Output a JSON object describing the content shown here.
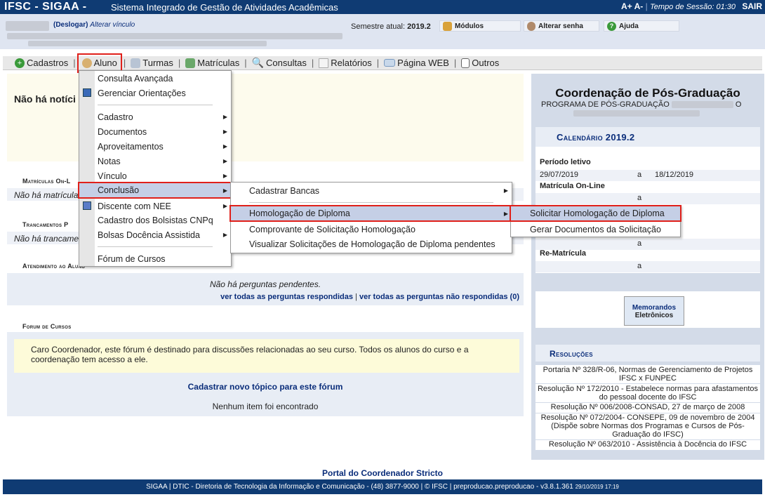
{
  "header": {
    "brand": "IFSC - SIGAA -",
    "subtitle": "Sistema Integrado de Gestão de Atividades Acadêmicas",
    "font_controls": "A+ A-",
    "session_label": "Tempo de Sessão: 01:30",
    "logout": "SAIR"
  },
  "userbar": {
    "deslogar": "(Deslogar)",
    "alterar_vinculo": "Alterar vínculo",
    "semestre_label": "Semestre atual:",
    "semestre_value": "2019.2",
    "modulos": "Módulos",
    "alterar_senha": "Alterar senha",
    "ajuda": "Ajuda"
  },
  "menu": {
    "cadastros": "Cadastros",
    "aluno": "Aluno",
    "turmas": "Turmas",
    "matriculas": "Matrículas",
    "consultas": "Consultas",
    "relatorios": "Relatórios",
    "pagina_web": "Página WEB",
    "outros": "Outros"
  },
  "aluno_menu": [
    "Consulta Avançada",
    "Gerenciar Orientações",
    "Cadastro",
    "Documentos",
    "Aproveitamentos",
    "Notas",
    "Vínculo",
    "Conclusão",
    "Discente com NEE",
    "Cadastro dos Bolsistas CNPq",
    "Bolsas Docência Assistida",
    "Fórum de Cursos"
  ],
  "conclusao_menu": [
    "Cadastrar Bancas",
    "Homologação de Diploma",
    "Comprovante de Solicitação Homologação",
    "Visualizar Solicitações de Homologação de Diploma pendentes"
  ],
  "homologacao_menu": [
    "Solicitar Homologação de Diploma",
    "Gerar Documentos da Solicitação"
  ],
  "main": {
    "no_news": "Não há notíci",
    "matriculas_title": "Matrículas On-L",
    "matriculas_text": "Não há matrícula",
    "trancamentos_title": "Trancamentos P",
    "trancamentos_text": "Não há trancame",
    "atendimento_title": "Atendimento ao Aluno",
    "no_questions": "Não há perguntas pendentes.",
    "link_respondidas": "ver todas as perguntas respondidas",
    "link_nao_respondidas": "ver todas as perguntas não respondidas (0)",
    "forum_title": "Forum de Cursos",
    "forum_text": "Caro Coordenador, este fórum é destinado para discussões relacionadas ao seu curso. Todos os alunos do curso e a coordenação tem acesso a ele.",
    "forum_link": "Cadastrar novo tópico para este fórum",
    "forum_empty": "Nenhum item foi encontrado"
  },
  "sidebar": {
    "title": "Coordenação de Pós-Graduação",
    "program": "PROGRAMA DE PÓS-GRADUAÇÃO",
    "program_end": "O",
    "calendar_title": "Calendário 2019.2",
    "periodo_label": "Período letivo",
    "periodo_start": "29/07/2019",
    "a": "a",
    "periodo_end": "18/12/2019",
    "matricula_label": "Matrícula On-Line",
    "rematricula_label": "Re-Matrícula",
    "memorandos_1": "Memorandos",
    "memorandos_2": "Eletrônicos",
    "resolucoes_title": "Resoluções",
    "resolucoes": [
      "Portaria Nº 328/R-06, Normas de Gerenciamento de Projetos IFSC x FUNPEC",
      "Resolução Nº 172/2010 - Estabelece normas para afastamentos do pessoal docente do IFSC",
      "Resolução Nº 006/2008-CONSAD, 27 de março de 2008",
      "Resolução Nº 072/2004- CONSEPE, 09 de novembro de 2004 (Dispõe sobre Normas dos Programas e Cursos de Pós-Graduação do IFSC)",
      "Resolução Nº 063/2010 - Assistência à Docência do IFSC"
    ]
  },
  "footer": {
    "portal": "Portal do Coordenador Stricto",
    "text": "SIGAA | DTIC - Diretoria de Tecnologia da Informação e Comunicação - (48) 3877-9000 | © IFSC | preproducao.preproducao - v3.8.1.361",
    "timestamp": "29/10/2019 17:19"
  },
  "colors": {
    "header": "#0f3b73",
    "highlight": "#e0201a",
    "menu_selected": "#c5cfe6"
  }
}
